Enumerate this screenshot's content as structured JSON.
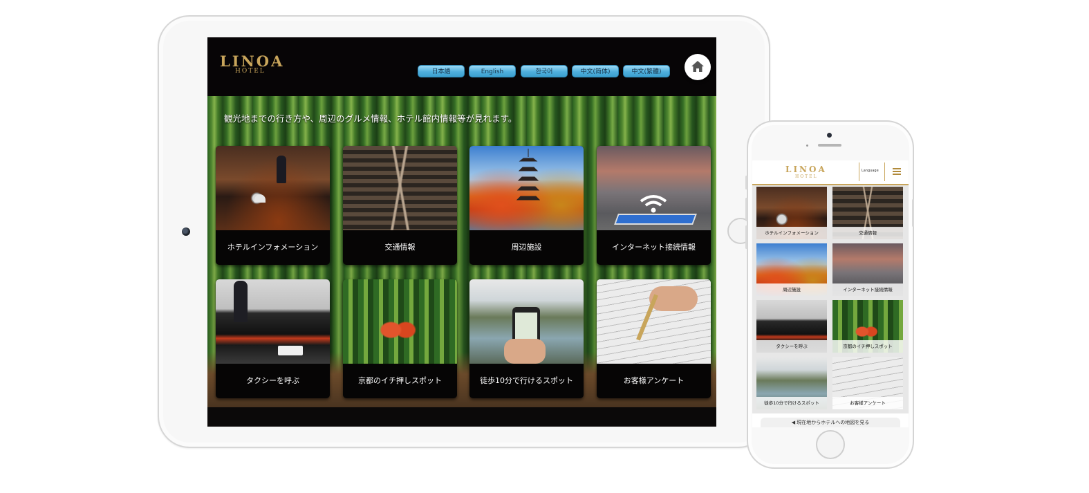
{
  "brand": {
    "name": "LINOA",
    "sub": "HOTEL",
    "gold": "#c8a55b"
  },
  "tablet": {
    "languages": [
      "日本語",
      "English",
      "한국어",
      "中文(简体)",
      "中文(繁體)"
    ],
    "home_icon": "home-icon",
    "intro": "観光地までの行き方や、周辺のグルメ情報、ホテル館内情報等が見れます。"
  },
  "menu": [
    {
      "label": "ホテルインフォメーション",
      "image": "hotel-bell"
    },
    {
      "label": "交通情報",
      "image": "railway-tracks"
    },
    {
      "label": "周辺施設",
      "image": "pagoda-autumn"
    },
    {
      "label": "インターネット接続情報",
      "image": "wifi-tablet"
    },
    {
      "label": "タクシーを呼ぶ",
      "image": "taxi"
    },
    {
      "label": "京都のイチ押しスポット",
      "image": "geisha-bamboo"
    },
    {
      "label": "徒歩10分で行けるスポット",
      "image": "smartphone-map"
    },
    {
      "label": "お客様アンケート",
      "image": "pen-survey"
    }
  ],
  "phone": {
    "language_label": "Language",
    "menu_icon": "hamburger-menu-icon",
    "map_button": "◀ 現在地からホテルへの地図を見る"
  },
  "colors": {
    "lang_button": "#4fb0dd",
    "screen_bg": "#070506"
  }
}
